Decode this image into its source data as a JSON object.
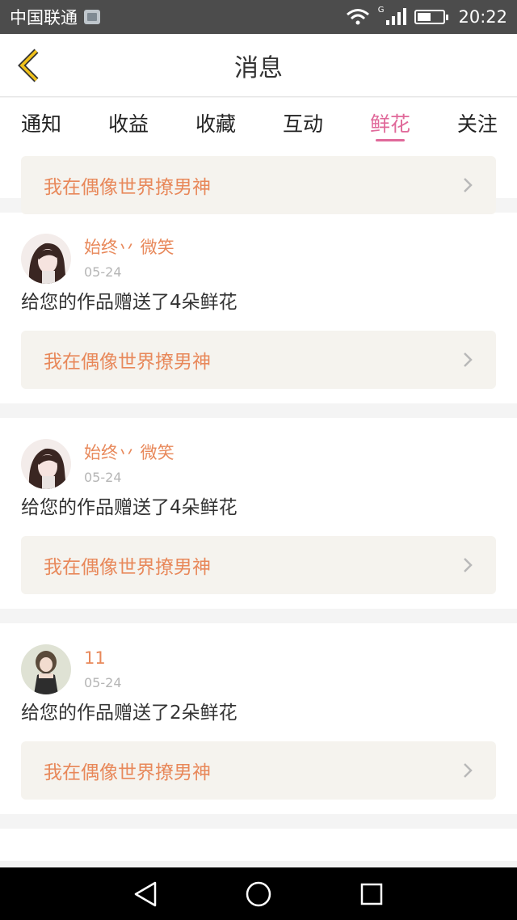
{
  "status_bar": {
    "carrier": "中国联通",
    "network": "G",
    "time": "20:22"
  },
  "header": {
    "title": "消息",
    "back_icon": "chevron-left-icon"
  },
  "tabs": [
    {
      "label": "通知",
      "active": false
    },
    {
      "label": "收益",
      "active": false
    },
    {
      "label": "收藏",
      "active": false
    },
    {
      "label": "互动",
      "active": false
    },
    {
      "label": "鲜花",
      "active": true
    },
    {
      "label": "关注",
      "active": false
    }
  ],
  "partial_item": {
    "work_title": "我在偶像世界撩男神"
  },
  "items": [
    {
      "user": "始终丷 微笑",
      "date": "05-24",
      "message": "给您的作品赠送了4朵鲜花",
      "work_title": "我在偶像世界撩男神"
    },
    {
      "user": "始终丷 微笑",
      "date": "05-24",
      "message": "给您的作品赠送了4朵鲜花",
      "work_title": "我在偶像世界撩男神"
    },
    {
      "user": "11",
      "date": "05-24",
      "message": "给您的作品赠送了2朵鲜花",
      "work_title": "我在偶像世界撩男神"
    }
  ],
  "colors": {
    "accent_pink": "#e0699a",
    "accent_orange": "#e8885a",
    "back_yellow": "#f1c21b"
  }
}
